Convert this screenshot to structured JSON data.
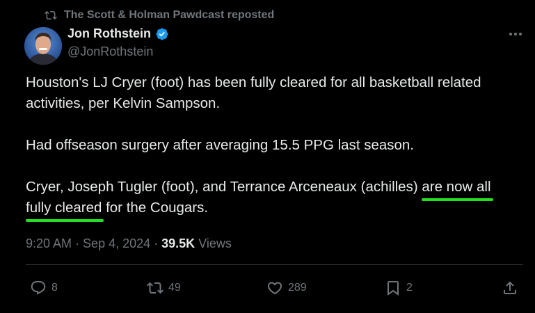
{
  "repost": {
    "label": "The Scott & Holman Pawdcast reposted",
    "icon": "repost-icon"
  },
  "author": {
    "name": "Jon Rothstein",
    "handle": "@JonRothstein",
    "verified_icon": "verified-badge-icon",
    "avatar": "avatar"
  },
  "more_icon": "more-options-icon",
  "tweet": {
    "para1_line1": "Houston's LJ Cryer (foot) has been fully cleared for all basketball related",
    "para1_line2": "activities, per Kelvin Sampson.",
    "para2": "Had offseason surgery after averaging 15.5 PPG last season.",
    "para3_part1": "Cryer, Joseph Tugler (foot), and Terrance Arceneaux (achilles) ",
    "para3_highlight1": "are now all",
    "para3_highlight2": "fully cleared",
    "para3_part2": " for the Cougars."
  },
  "meta": {
    "time": "9:20 AM",
    "sep1": "·",
    "date": "Sep 4, 2024",
    "sep2": "·",
    "views_count": "39.5K",
    "views_label": "Views"
  },
  "actions": {
    "replies": "8",
    "reposts": "49",
    "likes": "289",
    "bookmarks": "2"
  },
  "colors": {
    "background": "#000000",
    "text": "#e7e9ea",
    "muted": "#71767b",
    "verified": "#1d9bf0",
    "annotation_underline": "#22e01f"
  }
}
